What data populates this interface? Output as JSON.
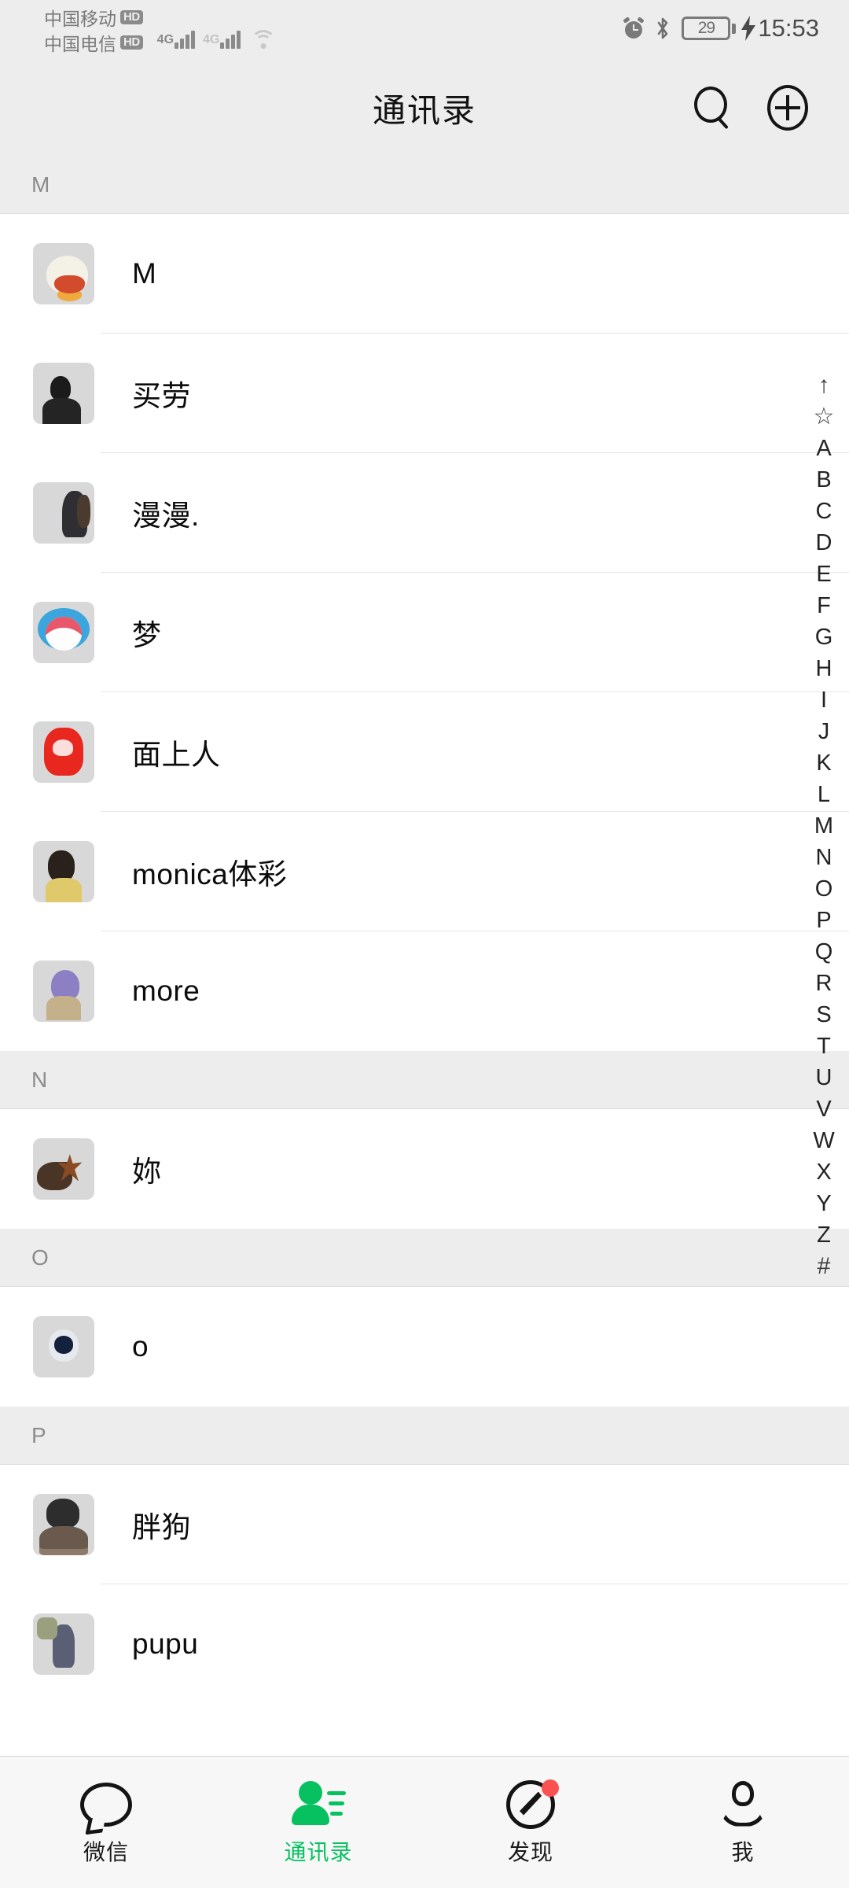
{
  "status_bar": {
    "carrier_1": "中国移动",
    "carrier_1_badge": "HD",
    "carrier_2": "中国电信",
    "carrier_2_badge": "HD",
    "network_1": "4G",
    "network_2": "4G",
    "battery_percent": "29",
    "time": "15:53",
    "icons": [
      "alarm-icon",
      "bluetooth-icon",
      "battery-icon",
      "charging-bolt-icon",
      "wifi-icon",
      "signal-icon"
    ]
  },
  "header": {
    "title": "通讯录",
    "search_icon": "search-icon",
    "add_icon": "add-contact-icon"
  },
  "sections": [
    {
      "letter": "M",
      "contacts": [
        {
          "name": "M",
          "avatar": "av-duck"
        },
        {
          "name": "买劳",
          "avatar": "av-bw"
        },
        {
          "name": "漫漫.",
          "avatar": "av-cliff"
        },
        {
          "name": "梦",
          "avatar": "av-doraemon"
        },
        {
          "name": "面上人",
          "avatar": "av-che"
        },
        {
          "name": "monica体彩",
          "avatar": "av-monica"
        },
        {
          "name": "more",
          "avatar": "av-anime"
        }
      ]
    },
    {
      "letter": "N",
      "contacts": [
        {
          "name": "妳",
          "avatar": "av-leaf"
        }
      ]
    },
    {
      "letter": "O",
      "contacts": [
        {
          "name": "o",
          "avatar": "av-astro"
        }
      ]
    },
    {
      "letter": "P",
      "contacts": [
        {
          "name": "胖狗",
          "avatar": "av-husky"
        },
        {
          "name": "pupu",
          "avatar": "av-snow"
        }
      ]
    }
  ],
  "alphabet_index": [
    "↑",
    "☆",
    "A",
    "B",
    "C",
    "D",
    "E",
    "F",
    "G",
    "H",
    "I",
    "J",
    "K",
    "L",
    "M",
    "N",
    "O",
    "P",
    "Q",
    "R",
    "S",
    "T",
    "U",
    "V",
    "W",
    "X",
    "Y",
    "Z",
    "#"
  ],
  "tab_bar": {
    "active_color": "#07c160",
    "badge_color": "#fa5151",
    "tabs": [
      {
        "label": "微信",
        "icon": "chat-bubble-icon",
        "active": false,
        "badge": false
      },
      {
        "label": "通讯录",
        "icon": "contacts-icon",
        "active": true,
        "badge": false
      },
      {
        "label": "发现",
        "icon": "compass-icon",
        "active": false,
        "badge": true
      },
      {
        "label": "我",
        "icon": "person-icon",
        "active": false,
        "badge": false
      }
    ]
  }
}
